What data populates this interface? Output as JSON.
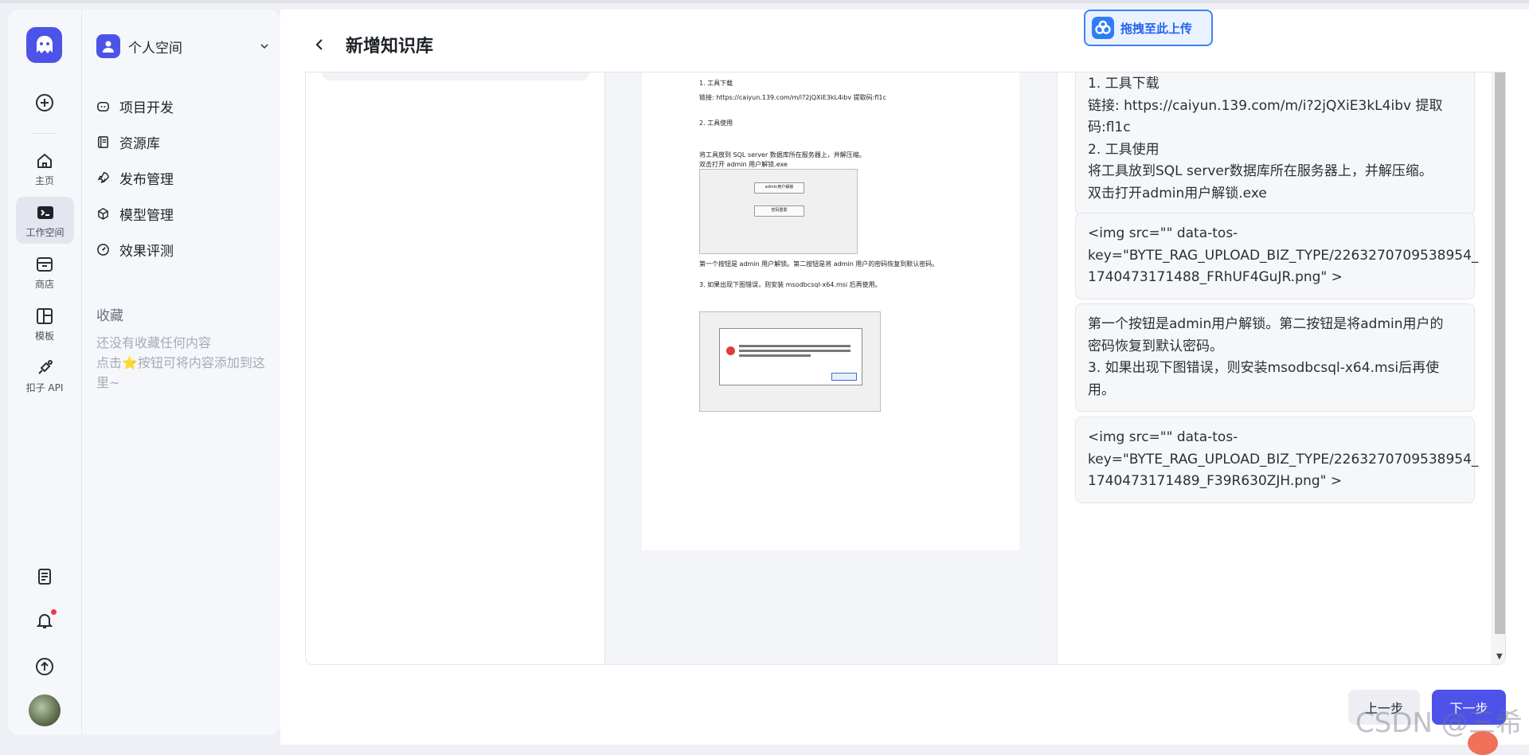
{
  "nav": {
    "items": [
      {
        "label": "主页",
        "icon": "home-icon"
      },
      {
        "label": "工作空间",
        "icon": "terminal-icon"
      },
      {
        "label": "商店",
        "icon": "store-icon"
      },
      {
        "label": "模板",
        "icon": "template-icon"
      },
      {
        "label": "扣子 API",
        "icon": "api-icon"
      }
    ]
  },
  "sidebar": {
    "space_name": "个人空间",
    "menu": [
      {
        "label": "项目开发",
        "icon": "bot-icon"
      },
      {
        "label": "资源库",
        "icon": "library-icon"
      },
      {
        "label": "发布管理",
        "icon": "rocket-icon"
      },
      {
        "label": "模型管理",
        "icon": "cube-icon"
      },
      {
        "label": "效果评测",
        "icon": "gauge-icon"
      }
    ],
    "favorites_title": "收藏",
    "favorites_empty_line1": "还没有收藏任何内容",
    "favorites_empty_line2": "点击⭐按钮可将内容添加到这里~"
  },
  "header": {
    "title": "新增知识库",
    "upload_badge": "拖拽至此上传"
  },
  "preview_doc": {
    "lines": [
      "1. 工具下载",
      "链接: https://caiyun.139.com/m/i?2jQXiE3kL4ibv 提取码:fl1c",
      "2. 工具使用",
      "将工具放到 SQL server 数据库所在服务器上，并解压缩。",
      "双击打开 admin 用户解锁.exe",
      "第一个按钮是 admin 用户解锁。第二按钮是将 admin 用户的密码恢复到默认密码。",
      "3. 如果出现下图错误，则安装 msodbcsql-x64.msi 后再使用。"
    ],
    "shot1_buttons": [
      "admin用户解锁",
      "密码重置"
    ]
  },
  "chunks": [
    {
      "lines": [
        "1. 工具下载",
        "链接: https://caiyun.139.com/m/i?2jQXiE3kL4ibv 提取",
        "码:fl1c",
        "2. 工具使用",
        "将工具放到SQL server数据库所在服务器上，并解压缩。",
        "双击打开admin用户解锁.exe"
      ]
    },
    {
      "lines": [
        "<img src=\"\" data-tos-",
        "key=\"BYTE_RAG_UPLOAD_BIZ_TYPE/2263270709538954_",
        "1740473171488_FRhUF4GuJR.png\" >"
      ]
    },
    {
      "lines": [
        "第一个按钮是admin用户解锁。第二按钮是将admin用户的",
        "密码恢复到默认密码。",
        "3. 如果出现下图错误，则安装msodbcsql-x64.msi后再使",
        "用。"
      ]
    },
    {
      "lines": [
        "<img src=\"\" data-tos-",
        "key=\"BYTE_RAG_UPLOAD_BIZ_TYPE/2263270709538954_",
        "1740473171489_F39R630ZJH.png\" >"
      ]
    }
  ],
  "footer": {
    "prev": "上一步",
    "next": "下一步"
  },
  "watermark": "CSDN @三希",
  "colors": {
    "accent": "#4d53e8",
    "upload": "#2563eb"
  }
}
